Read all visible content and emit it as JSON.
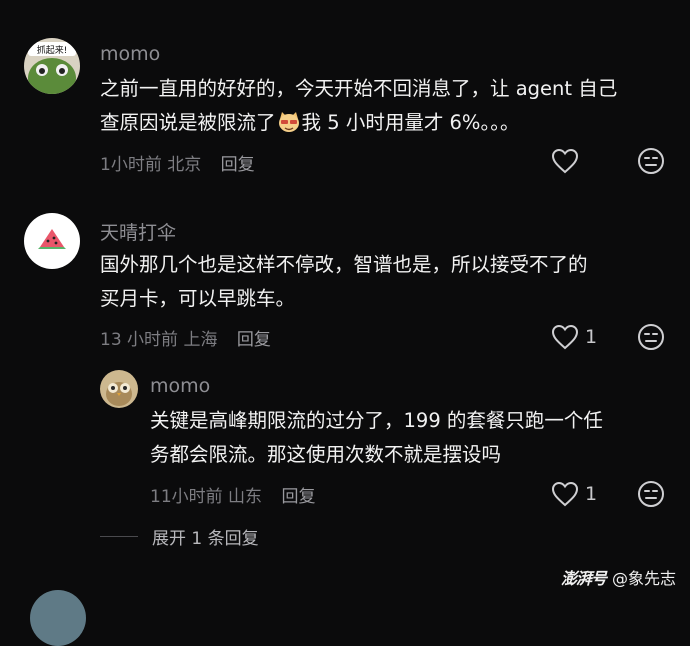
{
  "comments": [
    {
      "name": "momo",
      "avatar_text": "抓起来!",
      "line1": "之前一直用的好好的，今天开始不回消息了，让 agent 自己",
      "line2a": "查原因说是被限流了",
      "line2b": "我 5 小时用量才 6%。。。",
      "time": "1小时前",
      "location": "北京",
      "reply": "回复",
      "likes": ""
    },
    {
      "name": "天晴打伞",
      "line1": "国外那几个也是这样不停改，智谱也是，所以接受不了的",
      "line2": "买月卡，可以早跳车。",
      "time": "13 小时前",
      "location": "上海",
      "reply": "回复",
      "likes": "1"
    },
    {
      "name": "momo",
      "line1": "关键是高峰期限流的过分了，199 的套餐只跑一个任",
      "line2": "务都会限流。那这使用次数不就是摆设吗",
      "time": "11小时前",
      "location": "山东",
      "reply": "回复",
      "likes": "1"
    }
  ],
  "expand_label": "展开 1 条回复",
  "watermark": {
    "brand": "澎湃号",
    "author": "@象先志"
  },
  "icons": {
    "like": "heart-outline-icon",
    "dislike": "meh-face-icon",
    "inline_emoji": "cat-emoji-icon"
  }
}
